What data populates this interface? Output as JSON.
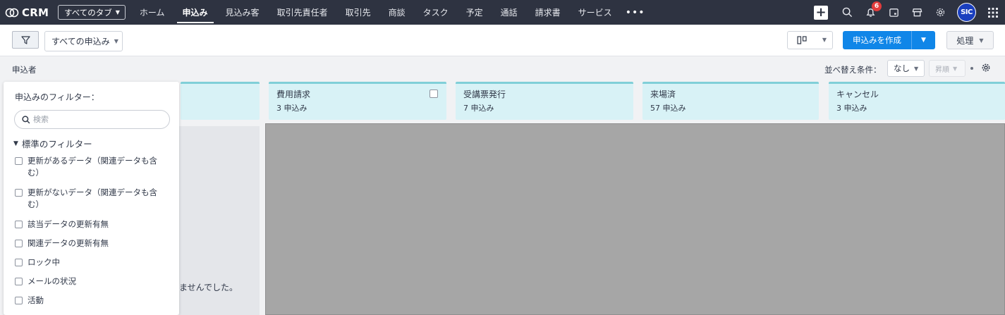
{
  "app": {
    "logo_text": "CRM",
    "all_tabs_label": "すべてのタブ"
  },
  "nav": {
    "tabs": [
      {
        "label": "ホーム",
        "active": false
      },
      {
        "label": "申込み",
        "active": true
      },
      {
        "label": "見込み客",
        "active": false
      },
      {
        "label": "取引先責任者",
        "active": false
      },
      {
        "label": "取引先",
        "active": false
      },
      {
        "label": "商談",
        "active": false
      },
      {
        "label": "タスク",
        "active": false
      },
      {
        "label": "予定",
        "active": false
      },
      {
        "label": "通話",
        "active": false
      },
      {
        "label": "請求書",
        "active": false
      },
      {
        "label": "サービス",
        "active": false
      }
    ],
    "more": "•••",
    "notification_count": "6",
    "avatar_text": "SIC"
  },
  "toolbar": {
    "view_label": "すべての申込み",
    "create_label": "申込みを作成",
    "action_label": "処理"
  },
  "subbar": {
    "applicant_label": "申込者",
    "sort_label": "並べ替え条件：",
    "sort_value": "なし",
    "order_value": "昇順"
  },
  "columns": [
    {
      "title": "費用請求",
      "count": "3 申込み"
    },
    {
      "title": "受講票発行",
      "count": "7 申込み"
    },
    {
      "title": "来場済",
      "count": "57 申込み"
    },
    {
      "title": "キャンセル",
      "count": "3 申込み"
    }
  ],
  "empty_message": "ませんでした。",
  "filter_panel": {
    "title": "申込みのフィルター：",
    "search_placeholder": "検索",
    "section_label": "標準のフィルター",
    "items": [
      "更新があるデータ（関連データも含む）",
      "更新がないデータ（関連データも含む）",
      "該当データの更新有無",
      "関連データの更新有無",
      "ロック中",
      "メールの状況",
      "活動"
    ]
  },
  "colors": {
    "nav_bg": "#2e3341",
    "accent": "#1086e8",
    "column_header": "#d8f2f6",
    "badge": "#e23c3c"
  }
}
